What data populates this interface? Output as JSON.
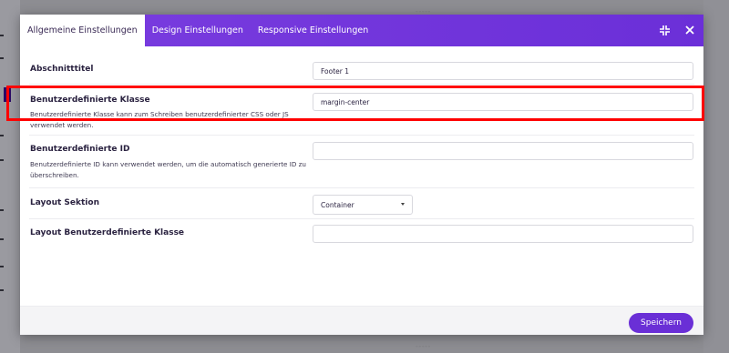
{
  "background": {
    "label_top": "-----",
    "label_bottom": "-----"
  },
  "modal": {
    "tabs": [
      {
        "label": "Allgemeine Einstellungen",
        "active": true
      },
      {
        "label": "Design Einstellungen",
        "active": false
      },
      {
        "label": "Responsive Einstellungen",
        "active": false
      }
    ],
    "icons": {
      "compress": "compress-icon",
      "close": "close-icon"
    },
    "fields": {
      "section_title": {
        "label": "Abschnitttitel",
        "value": "Footer 1"
      },
      "custom_class": {
        "label": "Benutzerdefinierte Klasse",
        "value": "margin-center",
        "description": "Benutzerdefinierte Klasse kann zum Schreiben benutzerdefinierter CSS oder JS verwendet werden."
      },
      "custom_id": {
        "label": "Benutzerdefinierte ID",
        "value": "",
        "description": "Benutzerdefinierte ID kann verwendet werden, um die automatisch generierte ID zu überschreiben."
      },
      "layout_section": {
        "label": "Layout Sektion",
        "selected": "Container"
      },
      "layout_custom_class": {
        "label": "Layout Benutzerdefinierte Klasse",
        "value": ""
      }
    },
    "footer": {
      "save_label": "Speichern"
    }
  },
  "colors": {
    "header_purple": "#6b2fd8",
    "button_purple": "#6a2fd6",
    "highlight_red": "#ff0000"
  }
}
